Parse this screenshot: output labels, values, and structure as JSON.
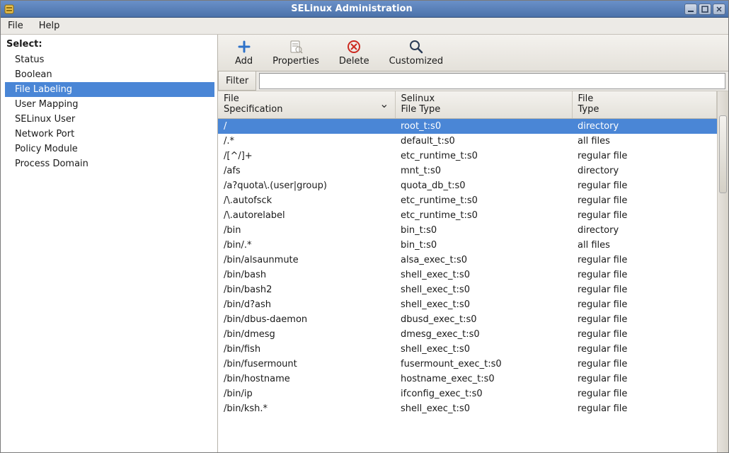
{
  "window": {
    "title": "SELinux Administration"
  },
  "menubar": {
    "file": "File",
    "help": "Help"
  },
  "sidebar": {
    "label": "Select:",
    "items": [
      {
        "label": "Status"
      },
      {
        "label": "Boolean"
      },
      {
        "label": "File Labeling",
        "selected": true
      },
      {
        "label": "User Mapping"
      },
      {
        "label": "SELinux User"
      },
      {
        "label": "Network Port"
      },
      {
        "label": "Policy Module"
      },
      {
        "label": "Process Domain"
      }
    ]
  },
  "toolbar": {
    "add": "Add",
    "properties": "Properties",
    "delete": "Delete",
    "customized": "Customized"
  },
  "filter": {
    "label": "Filter",
    "value": ""
  },
  "columns": {
    "spec_l1": "File",
    "spec_l2": "Specification",
    "sel_l1": "Selinux",
    "sel_l2": "File Type",
    "type_l1": "File",
    "type_l2": "Type"
  },
  "rows": [
    {
      "spec": "/",
      "sel": "root_t:s0",
      "type": "directory",
      "selected": true
    },
    {
      "spec": "/.*",
      "sel": "default_t:s0",
      "type": "all files"
    },
    {
      "spec": "/[^/]+",
      "sel": "etc_runtime_t:s0",
      "type": "regular file"
    },
    {
      "spec": "/afs",
      "sel": "mnt_t:s0",
      "type": "directory"
    },
    {
      "spec": "/a?quota\\.(user|group)",
      "sel": "quota_db_t:s0",
      "type": "regular file"
    },
    {
      "spec": "/\\.autofsck",
      "sel": "etc_runtime_t:s0",
      "type": "regular file"
    },
    {
      "spec": "/\\.autorelabel",
      "sel": "etc_runtime_t:s0",
      "type": "regular file"
    },
    {
      "spec": "/bin",
      "sel": "bin_t:s0",
      "type": "directory"
    },
    {
      "spec": "/bin/.*",
      "sel": "bin_t:s0",
      "type": "all files"
    },
    {
      "spec": "/bin/alsaunmute",
      "sel": "alsa_exec_t:s0",
      "type": "regular file"
    },
    {
      "spec": "/bin/bash",
      "sel": "shell_exec_t:s0",
      "type": "regular file"
    },
    {
      "spec": "/bin/bash2",
      "sel": "shell_exec_t:s0",
      "type": "regular file"
    },
    {
      "spec": "/bin/d?ash",
      "sel": "shell_exec_t:s0",
      "type": "regular file"
    },
    {
      "spec": "/bin/dbus-daemon",
      "sel": "dbusd_exec_t:s0",
      "type": "regular file"
    },
    {
      "spec": "/bin/dmesg",
      "sel": "dmesg_exec_t:s0",
      "type": "regular file"
    },
    {
      "spec": "/bin/fish",
      "sel": "shell_exec_t:s0",
      "type": "regular file"
    },
    {
      "spec": "/bin/fusermount",
      "sel": "fusermount_exec_t:s0",
      "type": "regular file"
    },
    {
      "spec": "/bin/hostname",
      "sel": "hostname_exec_t:s0",
      "type": "regular file"
    },
    {
      "spec": "/bin/ip",
      "sel": "ifconfig_exec_t:s0",
      "type": "regular file"
    },
    {
      "spec": "/bin/ksh.*",
      "sel": "shell_exec_t:s0",
      "type": "regular file"
    }
  ]
}
